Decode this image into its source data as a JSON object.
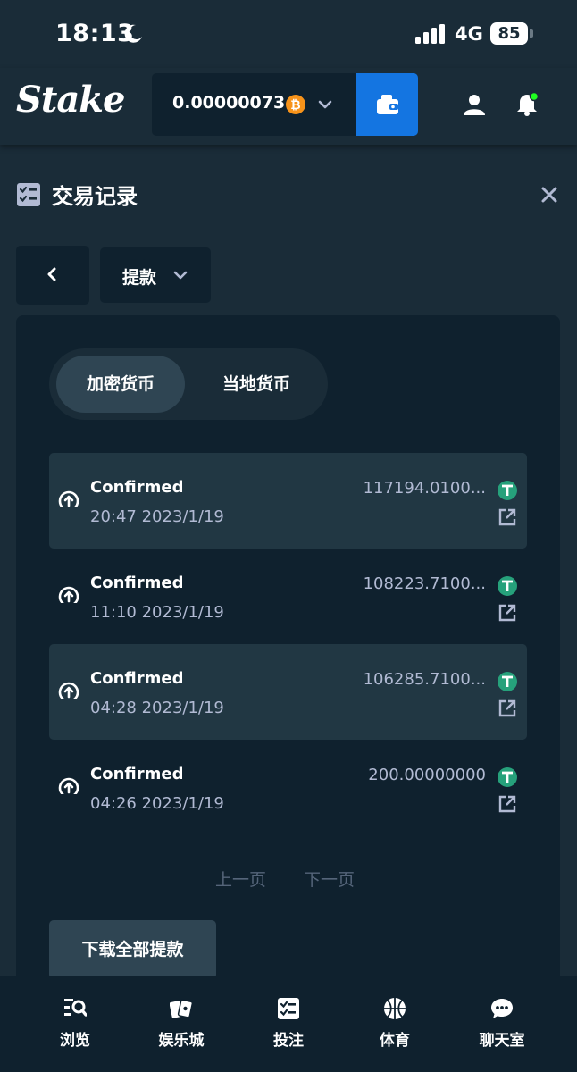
{
  "status_bar": {
    "time": "18:13",
    "network": "4G",
    "battery": "85"
  },
  "header": {
    "logo": "Stake",
    "balance": "0.00000073",
    "accent_color": "#1475e1"
  },
  "page": {
    "title": "交易记录",
    "type_select_label": "提款"
  },
  "tabs": [
    {
      "label": "加密货币",
      "active": true
    },
    {
      "label": "当地货币",
      "active": false
    }
  ],
  "transactions": [
    {
      "status": "Confirmed",
      "time": "20:47 2023/1/19",
      "amount": "117194.0100...",
      "currency_icon": "usdt-icon"
    },
    {
      "status": "Confirmed",
      "time": "11:10 2023/1/19",
      "amount": "108223.7100...",
      "currency_icon": "usdt-icon"
    },
    {
      "status": "Confirmed",
      "time": "04:28 2023/1/19",
      "amount": "106285.7100...",
      "currency_icon": "usdt-icon"
    },
    {
      "status": "Confirmed",
      "time": "04:26 2023/1/19",
      "amount": "200.00000000",
      "currency_icon": "usdt-icon"
    }
  ],
  "pagination": {
    "prev": "上一页",
    "next": "下一页"
  },
  "download_button": "下载全部提款",
  "bottom_nav": [
    {
      "label": "浏览",
      "icon": "browse-icon"
    },
    {
      "label": "娱乐城",
      "icon": "casino-icon"
    },
    {
      "label": "投注",
      "icon": "bets-icon"
    },
    {
      "label": "体育",
      "icon": "sports-icon"
    },
    {
      "label": "聊天室",
      "icon": "chat-icon"
    }
  ]
}
